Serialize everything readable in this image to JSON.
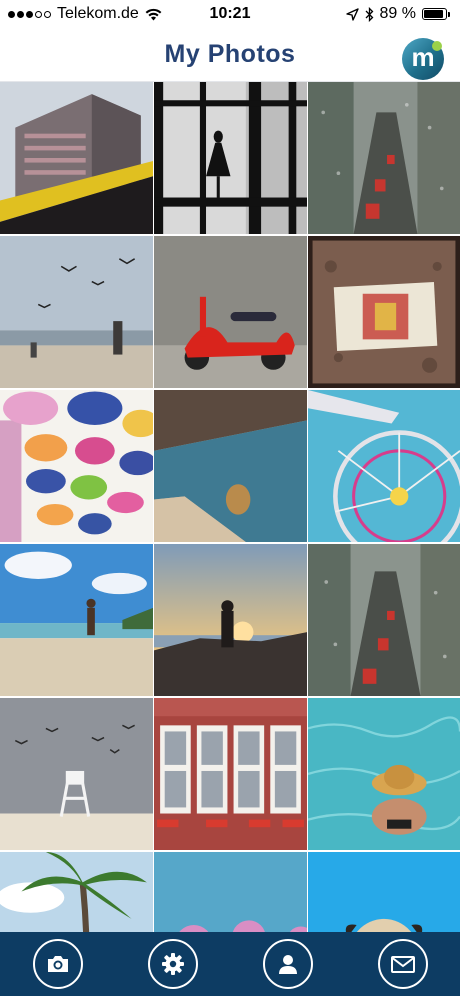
{
  "status_bar": {
    "carrier": "Telekom.de",
    "time": "10:21",
    "battery_percent": "89 %",
    "battery_level": 0.89,
    "signal_bars_filled": 3,
    "signal_bars_total": 5
  },
  "header": {
    "title": "My Photos",
    "logo_letter": "m",
    "title_color": "#264273"
  },
  "colors": {
    "tab_bar": "#0d3c63",
    "accent": "#264273"
  },
  "photos": [
    {
      "subject": "apartment building with yellow balcony rail"
    },
    {
      "subject": "silhouette of woman at large window"
    },
    {
      "subject": "rainy city street with traffic"
    },
    {
      "subject": "birds and people on beach"
    },
    {
      "subject": "red scooter by stone wall"
    },
    {
      "subject": "queen playing card on ground"
    },
    {
      "subject": "colorful umbrellas hanging over street"
    },
    {
      "subject": "reflection in puddle with blue sky"
    },
    {
      "subject": "ferris wheel against blue sky"
    },
    {
      "subject": "child running on beach"
    },
    {
      "subject": "couple at sunset on rocks"
    },
    {
      "subject": "rainy city street with traffic"
    },
    {
      "subject": "lifeguard chair on beach with birds"
    },
    {
      "subject": "white windows with flower boxes"
    },
    {
      "subject": "person with straw hat in pool"
    },
    {
      "subject": "palm trees against sky"
    },
    {
      "subject": "pink blossoms against blue sky"
    },
    {
      "subject": "pug on blue background"
    }
  ],
  "tab_bar": [
    {
      "icon": "camera-icon"
    },
    {
      "icon": "gear-icon"
    },
    {
      "icon": "person-icon"
    },
    {
      "icon": "mail-icon"
    }
  ]
}
